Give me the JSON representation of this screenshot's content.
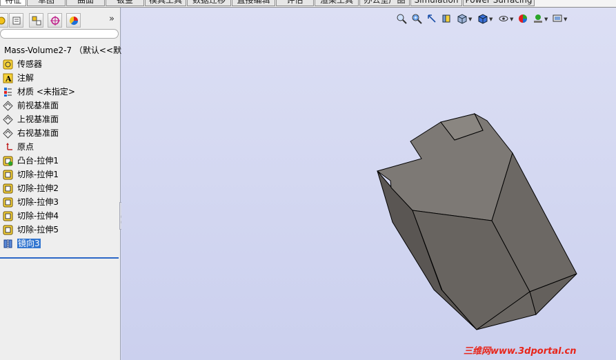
{
  "tabs": [
    {
      "label": "特征",
      "active": true
    },
    {
      "label": "草图",
      "active": false
    },
    {
      "label": "曲面",
      "active": false
    },
    {
      "label": "钣金",
      "active": false
    },
    {
      "label": "模具工具",
      "active": false
    },
    {
      "label": "数据迁移",
      "active": false
    },
    {
      "label": "直接编辑",
      "active": false
    },
    {
      "label": "评估",
      "active": false
    },
    {
      "label": "渲染工具",
      "active": false
    },
    {
      "label": "办公室产品",
      "active": false
    },
    {
      "label": "Simulation",
      "active": false
    },
    {
      "label": "Power Surfacing",
      "active": false
    }
  ],
  "panel": {
    "tab_icons": [
      "feature-manager-icon",
      "property-manager-icon",
      "configuration-manager-icon",
      "dimxpert-icon",
      "display-manager-icon"
    ],
    "more": "»"
  },
  "tree": {
    "root": "Mass-Volume2-7 （默认<<默",
    "items": [
      {
        "label": "传感器",
        "icon": "sensor-icon"
      },
      {
        "label": "注解",
        "icon": "annotation-icon"
      },
      {
        "label": "材质 <未指定>",
        "icon": "material-icon"
      },
      {
        "label": "前视基准面",
        "icon": "plane-icon"
      },
      {
        "label": "上视基准面",
        "icon": "plane-icon"
      },
      {
        "label": "右视基准面",
        "icon": "plane-icon"
      },
      {
        "label": "原点",
        "icon": "origin-icon"
      },
      {
        "label": "凸台-拉伸1",
        "icon": "boss-extrude-icon"
      },
      {
        "label": "切除-拉伸1",
        "icon": "cut-extrude-icon"
      },
      {
        "label": "切除-拉伸2",
        "icon": "cut-extrude-icon"
      },
      {
        "label": "切除-拉伸3",
        "icon": "cut-extrude-icon"
      },
      {
        "label": "切除-拉伸4",
        "icon": "cut-extrude-icon"
      },
      {
        "label": "切除-拉伸5",
        "icon": "cut-extrude-icon"
      },
      {
        "label": "镜向3",
        "icon": "mirror-icon",
        "selected": true
      }
    ]
  },
  "hud": [
    "zoom-to-fit-icon",
    "zoom-to-area-icon",
    "previous-view-icon",
    "section-view-icon",
    "view-orientation-icon",
    "display-style-icon",
    "hide-show-items-icon",
    "edit-appearance-icon",
    "apply-scene-icon",
    "view-settings-icon"
  ],
  "watermark": "三维网www.3dportal.cn",
  "colors": {
    "viewport_top": "#dcdff4",
    "viewport_bottom": "#cbd0ee",
    "model_face": "#7a7672",
    "selection": "#3376d0",
    "watermark": "#e8251a"
  }
}
